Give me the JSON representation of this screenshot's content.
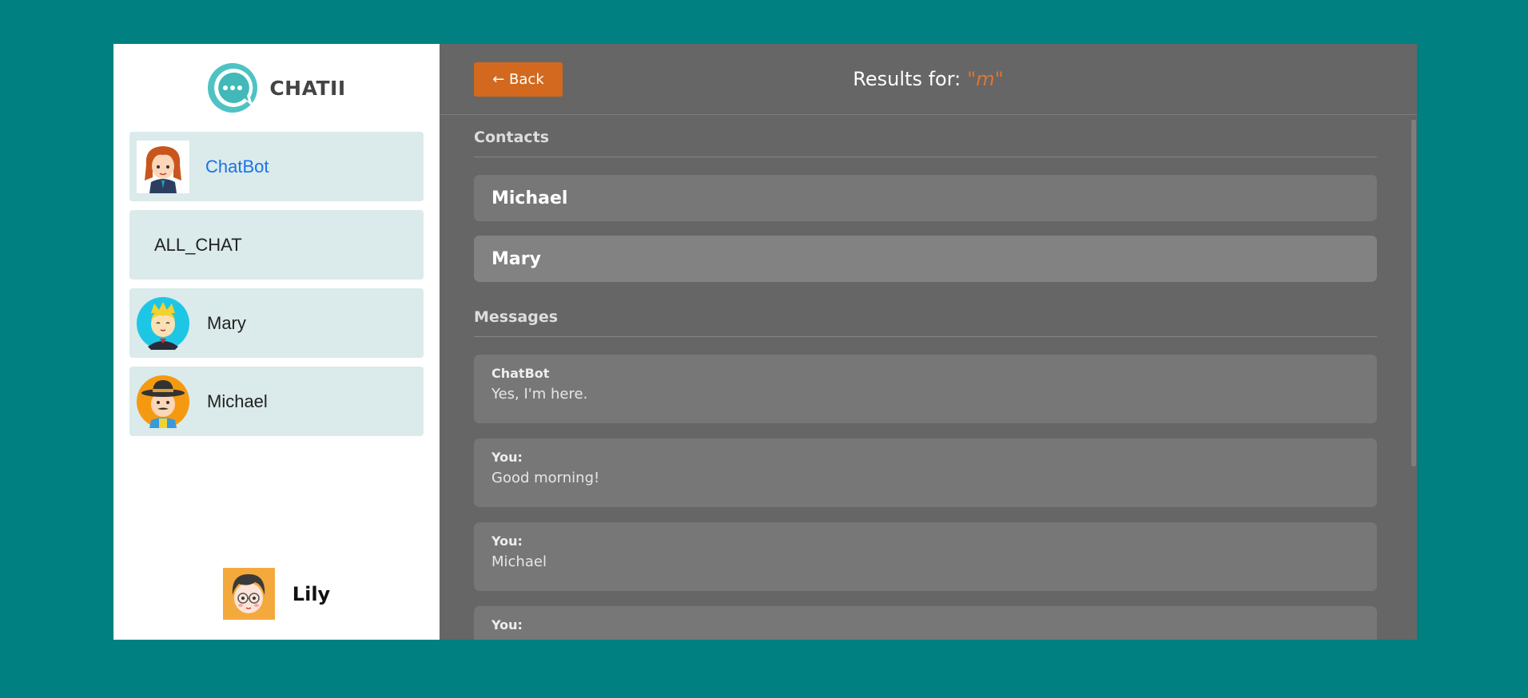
{
  "brand": {
    "name": "CHATII",
    "logo_icon": "chat-bubble-icon",
    "accent": "#3fb8b8"
  },
  "sidebar": {
    "contacts": [
      {
        "label": "ChatBot",
        "icon": "chatbot-avatar",
        "active": true
      },
      {
        "label": "ALL_CHAT",
        "icon": "",
        "active": false
      },
      {
        "label": "Mary",
        "icon": "mary-avatar",
        "active": false
      },
      {
        "label": "Michael",
        "icon": "michael-avatar",
        "active": false
      }
    ],
    "user": {
      "name": "Lily",
      "icon": "lily-avatar"
    }
  },
  "header": {
    "back_label": "← Back",
    "results_prefix": "Results for:",
    "query": "\"m\""
  },
  "results": {
    "contacts_title": "Contacts",
    "contacts": [
      "Michael",
      "Mary"
    ],
    "messages_title": "Messages",
    "messages": [
      {
        "sender": "ChatBot",
        "text": "Yes, I'm here."
      },
      {
        "sender": "You:",
        "text": "Good morning!"
      },
      {
        "sender": "You:",
        "text": "Michael"
      },
      {
        "sender": "You:",
        "text": ""
      }
    ]
  },
  "colors": {
    "background": "#008080",
    "panel": "#666666",
    "card": "#777777",
    "button": "#d2691e",
    "query": "#e2742f",
    "contact_bg": "#dbeaea",
    "active_contact_text": "#1a73e8"
  }
}
